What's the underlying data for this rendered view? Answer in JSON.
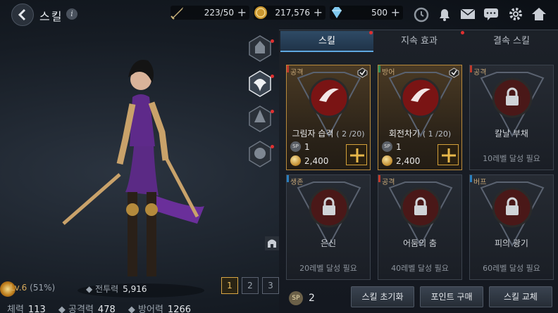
{
  "header": {
    "title": "스킬",
    "info_icon": "i"
  },
  "resources": [
    {
      "icon": "sword-icon",
      "value": "223/50"
    },
    {
      "icon": "gold-coin-icon",
      "value": "217,576"
    },
    {
      "icon": "diamond-icon",
      "value": "500"
    }
  ],
  "top_icons": [
    "clock-icon",
    "bell-icon",
    "mail-icon",
    "chat-icon",
    "gear-icon",
    "home-icon"
  ],
  "class_icons": [
    "class-warrior-icon",
    "class-assassin-icon",
    "class-mage-icon",
    "class-archer-icon"
  ],
  "character": {
    "level": "Lv.6",
    "level_pct": "(51%)",
    "power_label": "전투력",
    "power": "5,916"
  },
  "stats": [
    {
      "label": "체력",
      "value": "113"
    },
    {
      "label": "공격력",
      "value": "478"
    },
    {
      "label": "방어력",
      "value": "1266"
    }
  ],
  "pages": [
    "1",
    "2",
    "3"
  ],
  "tabs": [
    "스킬",
    "지속 효과",
    "결속 스킬"
  ],
  "skills": [
    {
      "tag": "공격",
      "tag_color": "#c0392b",
      "name": "그림자 습격",
      "level": "( 2 /20)",
      "sp_label": "SP",
      "sp": "1",
      "cost": "2,400",
      "active": true,
      "locked": false
    },
    {
      "tag": "방어",
      "tag_color": "#2e8b57",
      "name": "회전차기",
      "level": "( 1 /20)",
      "sp_label": "SP",
      "sp": "1",
      "cost": "2,400",
      "active": true,
      "locked": false
    },
    {
      "tag": "공격",
      "tag_color": "#c0392b",
      "name": "칼날 부채",
      "req": "10레벨 달성 필요",
      "active": false,
      "locked": true
    },
    {
      "tag": "생존",
      "tag_color": "#2a7fbf",
      "name": "은신",
      "req": "20레벨 달성 필요",
      "active": false,
      "locked": true
    },
    {
      "tag": "공격",
      "tag_color": "#c0392b",
      "name": "어둠의 춤",
      "req": "40레벨 달성 필요",
      "active": false,
      "locked": true
    },
    {
      "tag": "버프",
      "tag_color": "#2a7fbf",
      "name": "피의 광기",
      "req": "60레벨 달성 필요",
      "active": false,
      "locked": true
    }
  ],
  "footer": {
    "sp_label": "SP",
    "sp_points": "2",
    "buttons": [
      "스킬 초기화",
      "포인트 구매",
      "스킬 교체"
    ]
  },
  "colors": {
    "accent_gold": "#d4a13a",
    "tab_active": "#2f4b66",
    "tag_red": "#c0392b"
  }
}
